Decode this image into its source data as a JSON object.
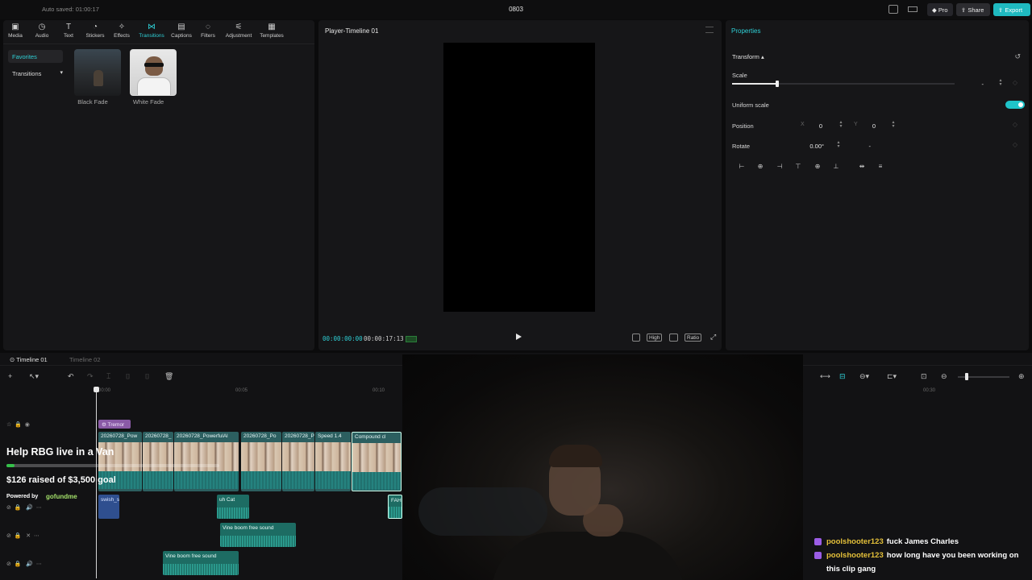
{
  "app": {
    "autosave": "Auto saved: 01:00:17",
    "project_title": "0803",
    "pro_label": "Pro",
    "share_label": "Share",
    "export_label": "Export"
  },
  "media_tabs": [
    {
      "label": "Media",
      "icon": "media-icon"
    },
    {
      "label": "Audio",
      "icon": "audio-icon"
    },
    {
      "label": "Text",
      "icon": "text-icon"
    },
    {
      "label": "Stickers",
      "icon": "sticker-icon"
    },
    {
      "label": "Effects",
      "icon": "effects-icon"
    },
    {
      "label": "Transitions",
      "icon": "transitions-icon",
      "active": true
    },
    {
      "label": "Captions",
      "icon": "captions-icon"
    },
    {
      "label": "Filters",
      "icon": "filters-icon"
    },
    {
      "label": "Adjustment",
      "icon": "adjustment-icon"
    },
    {
      "label": "Templates",
      "icon": "templates-icon"
    }
  ],
  "media_sidebar": {
    "favorites": "Favorites",
    "transitions": "Transitions"
  },
  "transition_items": [
    {
      "label": "Black Fade"
    },
    {
      "label": "White Fade"
    }
  ],
  "player": {
    "title": "Player-Timeline 01",
    "current_time": "00:00:00:00",
    "total_time": "00:00:17:13",
    "quality": "High",
    "ratio": "Ratio"
  },
  "properties": {
    "title": "Properties",
    "section": "Transform",
    "scale_label": "Scale",
    "scale_value": "-",
    "uniform_scale_label": "Uniform scale",
    "uniform_scale_on": true,
    "position_label": "Position",
    "x_axis": "X",
    "x_value": "0",
    "y_axis": "Y",
    "y_value": "0",
    "rotate_label": "Rotate",
    "rotate_value": "0.00°",
    "rotate_extra": "-"
  },
  "timeline": {
    "tabs": [
      "Timeline 01",
      "Timeline 02"
    ],
    "ruler": [
      "00:00",
      "00:05",
      "00:10",
      "00:30"
    ],
    "clips": {
      "tremor": "Tremor",
      "video_labels": [
        "20260728_Pow",
        "20260728_",
        "20260728_PowerfulAl",
        "20260728_Po",
        "20260728_P",
        "Speed 1.4",
        "Compound cl"
      ],
      "audio1": "Vine boom free sound",
      "audio2": "Vine boom free sound",
      "cat_label": "uh Cat",
      "blue_label": "swish_s",
      "fah_label": "FAH"
    }
  },
  "overlay": {
    "fundraiser_title": "Help RBG live in a Van",
    "fundraiser_raised": "$126 raised of $3,500 goal",
    "fundraiser_progress": 0.036,
    "powered_by": "Powered by",
    "provider": "gofundme"
  },
  "chat": [
    {
      "user": "poolshooter123",
      "message": "fuck James Charles"
    },
    {
      "user": "poolshooter123",
      "message": "how long have you been working on this clip gang"
    }
  ],
  "colors": {
    "accent": "#2fd0d6",
    "export": "#1fb9c0",
    "chat_user": "#e5c13a",
    "progress": "#35c04a"
  }
}
